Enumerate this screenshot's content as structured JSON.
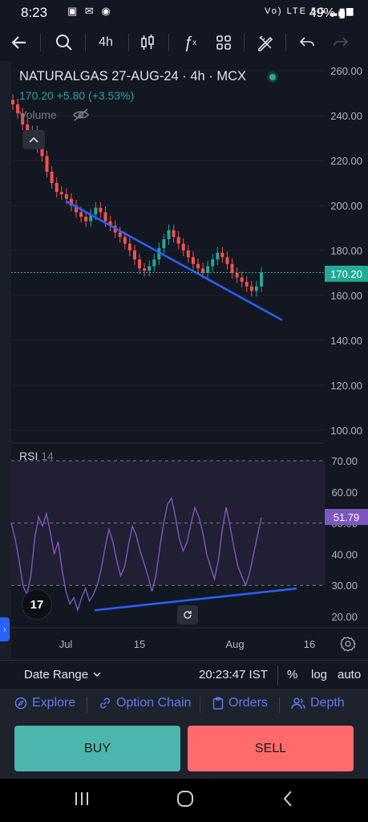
{
  "status_bar": {
    "time": "8:23",
    "battery": "49%",
    "network": "Vo) LTE",
    "signal": "5G"
  },
  "toolbar": {
    "back_icon": "arrow-left-icon",
    "search_icon": "search-icon",
    "interval": "4h",
    "chart_type_icon": "candlestick-icon",
    "indicators_icon": "function-icon",
    "layout_icon": "grid-icon",
    "drawing_icon": "pencil-ruler-icon",
    "undo_icon": "undo-icon",
    "redo_icon": "redo-icon"
  },
  "chart": {
    "symbol_line": "NATURALGAS 27-AUG-24 · 4h · MCX",
    "last_price": "170.20",
    "change": "+5.80 (+3.53%)",
    "volume_label": "Volume",
    "current_price_label": "170.20",
    "rsi_label": "RSI",
    "rsi_length": "14",
    "rsi_value_label": "51.79",
    "x_labels": [
      "Jul",
      "15",
      "Aug",
      "16"
    ],
    "colors": {
      "up": "#26a69a",
      "down": "#ef5350",
      "trendline": "#2962ff",
      "rsi_line": "#7e57c2",
      "price_tag": "#22ab94",
      "rsi_tag": "#7e57c2"
    }
  },
  "chart_data": [
    {
      "type": "candlestick",
      "title": "NATURALGAS 27-AUG-24 · 4h · MCX",
      "y_ticks": [
        260,
        240,
        220,
        200,
        180,
        160,
        140,
        120,
        100
      ],
      "ylim": [
        95,
        265
      ],
      "x_ticks": [
        "Jul",
        "15",
        "Aug",
        "16"
      ],
      "last_value": 170.2,
      "close_series": [
        245,
        241,
        236,
        230,
        233,
        226,
        222,
        215,
        210,
        206,
        205,
        203,
        200,
        197,
        195,
        193,
        196,
        199,
        197,
        193,
        191,
        188,
        186,
        183,
        180,
        176,
        172,
        171,
        173,
        176,
        181,
        185,
        189,
        186,
        183,
        180,
        177,
        174,
        172,
        170,
        173,
        176,
        179,
        177,
        174,
        170,
        168,
        166,
        164,
        162,
        164,
        170.2
      ],
      "trendline": [
        {
          "x": "start",
          "y": 202
        },
        {
          "x": "end",
          "y": 149
        }
      ]
    },
    {
      "type": "line",
      "title": "RSI 14",
      "y_ticks": [
        70,
        60,
        50,
        40,
        30,
        20
      ],
      "ylim": [
        15,
        72
      ],
      "reference_lines": [
        70,
        50,
        30
      ],
      "last_value": 51.79,
      "values": [
        50,
        45,
        38,
        30,
        27,
        33,
        45,
        52,
        49,
        53,
        47,
        40,
        44,
        35,
        28,
        24,
        26,
        22,
        26,
        29,
        25,
        27,
        30,
        35,
        42,
        48,
        44,
        38,
        33,
        36,
        43,
        49,
        46,
        41,
        37,
        33,
        28,
        33,
        42,
        50,
        56,
        58,
        52,
        45,
        41,
        44,
        50,
        55,
        52,
        47,
        40,
        36,
        32,
        38,
        48,
        55,
        49,
        42,
        36,
        33,
        30,
        34,
        40,
        46,
        51.79
      ],
      "trendline": [
        {
          "x": "start",
          "y": 22
        },
        {
          "x": "end",
          "y": 29
        }
      ]
    }
  ],
  "range_bar": {
    "date_range_label": "Date Range",
    "time": "20:23:47 IST",
    "percent_label": "%",
    "log_label": "log",
    "auto_label": "auto"
  },
  "nav": {
    "explore": "Explore",
    "option_chain": "Option Chain",
    "orders": "Orders",
    "depth": "Depth"
  },
  "trade": {
    "buy_label": "BUY",
    "sell_label": "SELL",
    "buy_color": "#4db6ac",
    "sell_color": "#ff6b6b"
  }
}
